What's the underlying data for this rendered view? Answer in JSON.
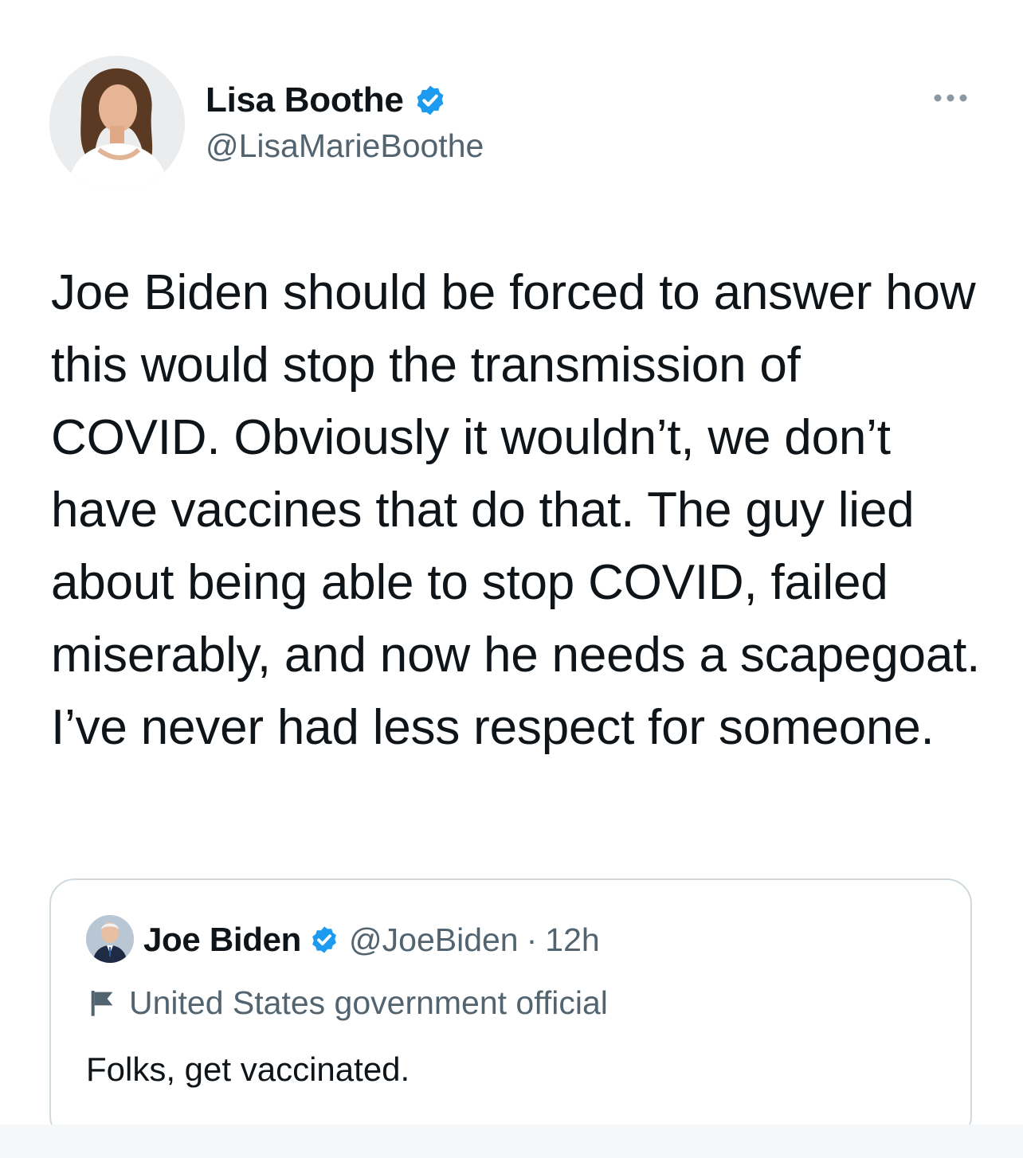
{
  "tweet": {
    "author": {
      "display_name": "Lisa Boothe",
      "handle": "@LisaMarieBoothe",
      "verified": true
    },
    "more_icon": "more-dots-icon",
    "text": "Joe Biden should be forced to answer how this would stop the transmission of COVID. Obviously it wouldn’t, we don’t have vaccines that do that. The guy lied about being able to stop COVID, failed miserably, and now he needs a scapegoat. I’ve never had less respect for someone."
  },
  "quoted_tweet": {
    "author": {
      "display_name": "Joe Biden",
      "handle": "@JoeBiden",
      "verified": true
    },
    "separator": "·",
    "time": "12h",
    "label_icon": "flag-icon",
    "label": "United States government official",
    "text": "Folks, get vaccinated."
  },
  "colors": {
    "text_primary": "#0f1419",
    "text_secondary": "#536471",
    "verified_blue": "#1d9bf0",
    "border": "#cfd9de"
  }
}
